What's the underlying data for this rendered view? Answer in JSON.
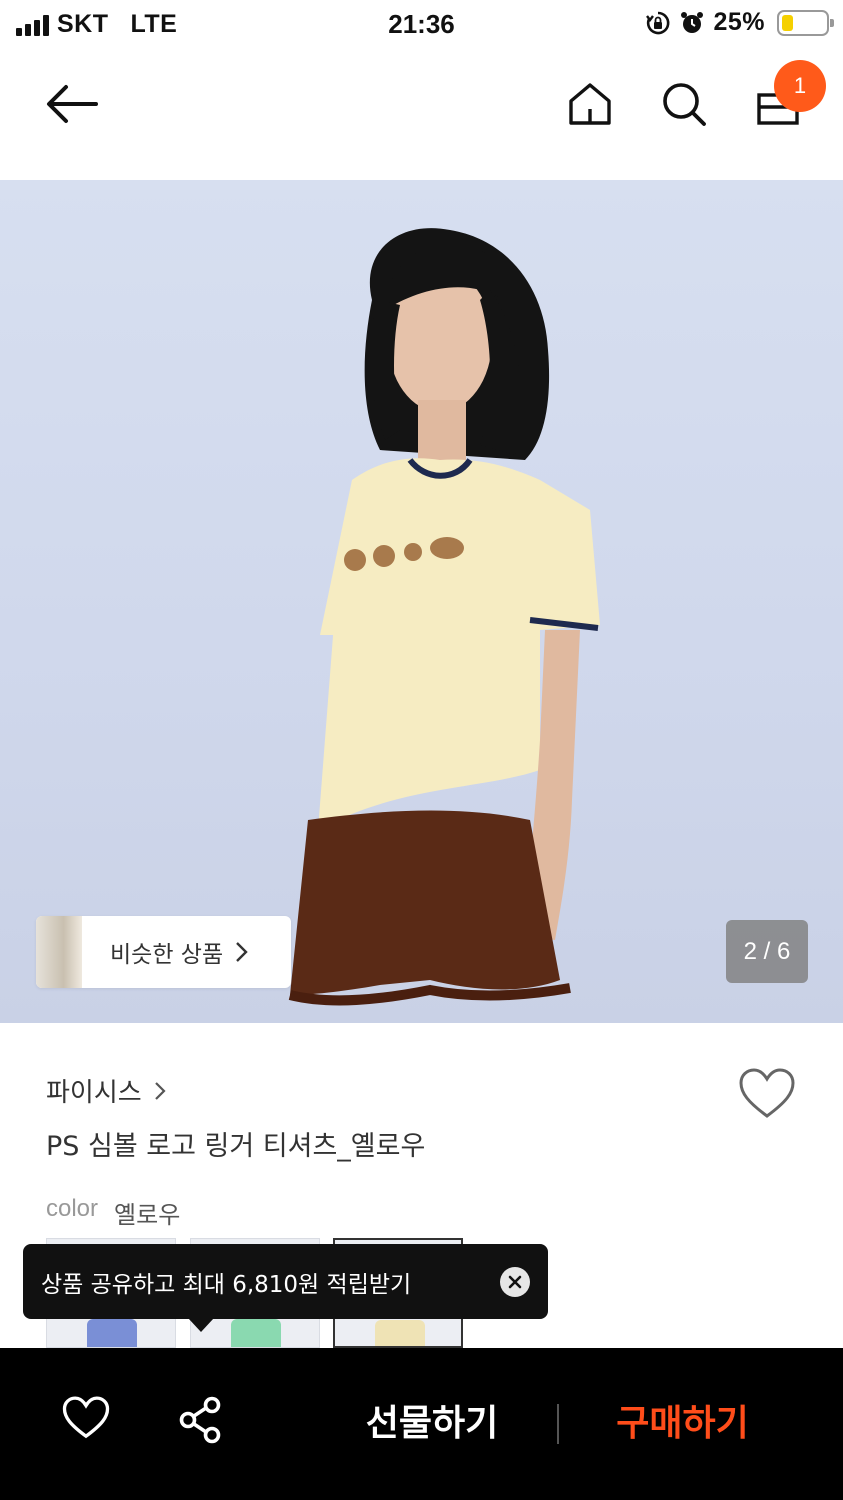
{
  "status_bar": {
    "carrier": "SKT",
    "network": "LTE",
    "time": "21:36",
    "battery_percent": "25%",
    "battery_level": 0.25,
    "icons": [
      "signal-icon",
      "orientation-lock-icon",
      "alarm-icon",
      "battery-icon"
    ]
  },
  "header": {
    "icons": [
      "back-arrow-icon",
      "home-icon",
      "search-icon",
      "shopping-bag-icon"
    ],
    "cart_count": "1",
    "badge_color": "#ff5a1a"
  },
  "hero": {
    "similar_label": "비슷한 상품",
    "image_counter": "2 / 6"
  },
  "product": {
    "brand": "파이시스",
    "title": "PS 심볼 로고 링거 티셔츠_옐로우",
    "color_key": "color",
    "color_value": "옐로우",
    "swatches": [
      {
        "accent": "#7a8fd6",
        "selected": false
      },
      {
        "accent": "#8ad9b0",
        "selected": false
      },
      {
        "accent": "#efe3b5",
        "selected": true
      }
    ]
  },
  "tooltip": {
    "text": "상품 공유하고 최대 6,810원 적립받기"
  },
  "bottom_bar": {
    "gift_label": "선물하기",
    "buy_label": "구매하기",
    "buy_color": "#ff4d1a",
    "icons": [
      "heart-icon",
      "share-icon"
    ]
  }
}
